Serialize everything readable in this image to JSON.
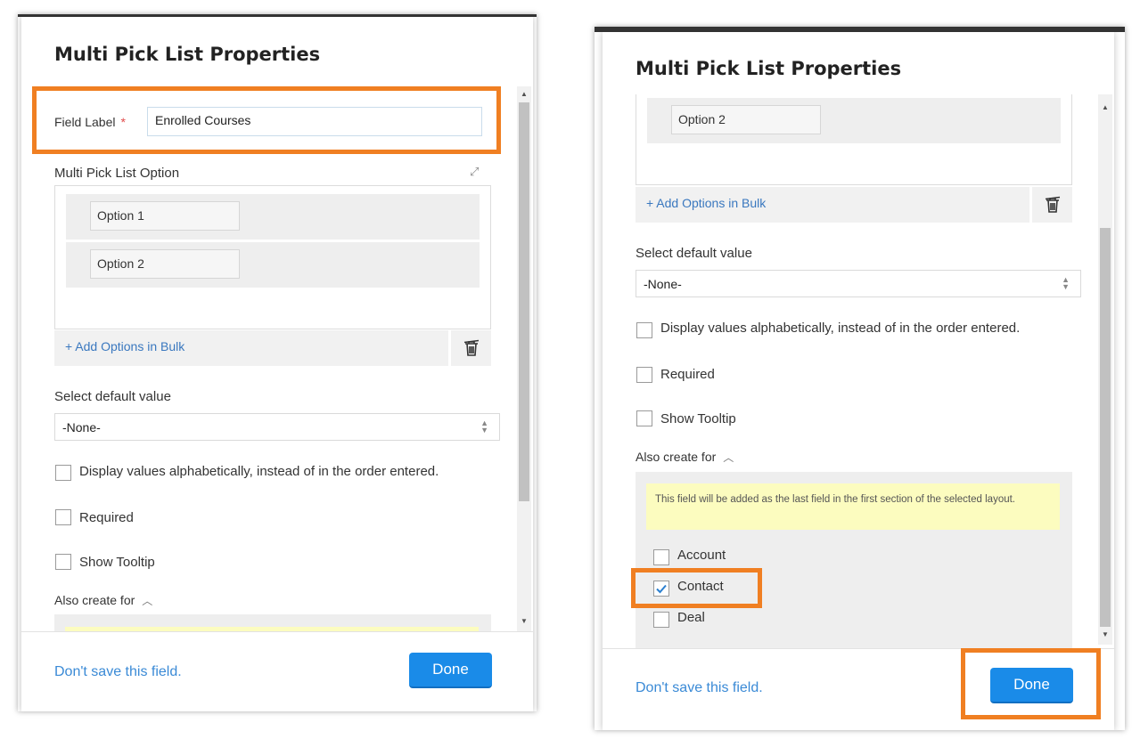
{
  "title": "Multi Pick List Properties",
  "field_label": {
    "label": "Field Label",
    "required_mark": "*",
    "value": "Enrolled Courses"
  },
  "options_section": {
    "label": "Multi Pick List Option",
    "options": [
      "Option 1",
      "Option 2"
    ],
    "add_bulk": "+ Add Options in Bulk"
  },
  "default_value": {
    "label": "Select default value",
    "selected": "-None-"
  },
  "checkboxes": {
    "alphabetical": "Display values alphabetically, instead of in the order entered.",
    "required": "Required",
    "tooltip": "Show Tooltip"
  },
  "also_create": {
    "label": "Also create for",
    "note": "This field will be added as the last field in the first section of the selected layout.",
    "modules": [
      {
        "name": "Account",
        "checked": false
      },
      {
        "name": "Contact",
        "checked": true
      },
      {
        "name": "Deal",
        "checked": false
      }
    ]
  },
  "footer": {
    "dont_save": "Don't save this field.",
    "done": "Done"
  },
  "colors": {
    "highlight": "#f07f22",
    "primary": "#1a8be8",
    "link": "#3a8ad6",
    "note_bg": "#fcfcbf"
  }
}
